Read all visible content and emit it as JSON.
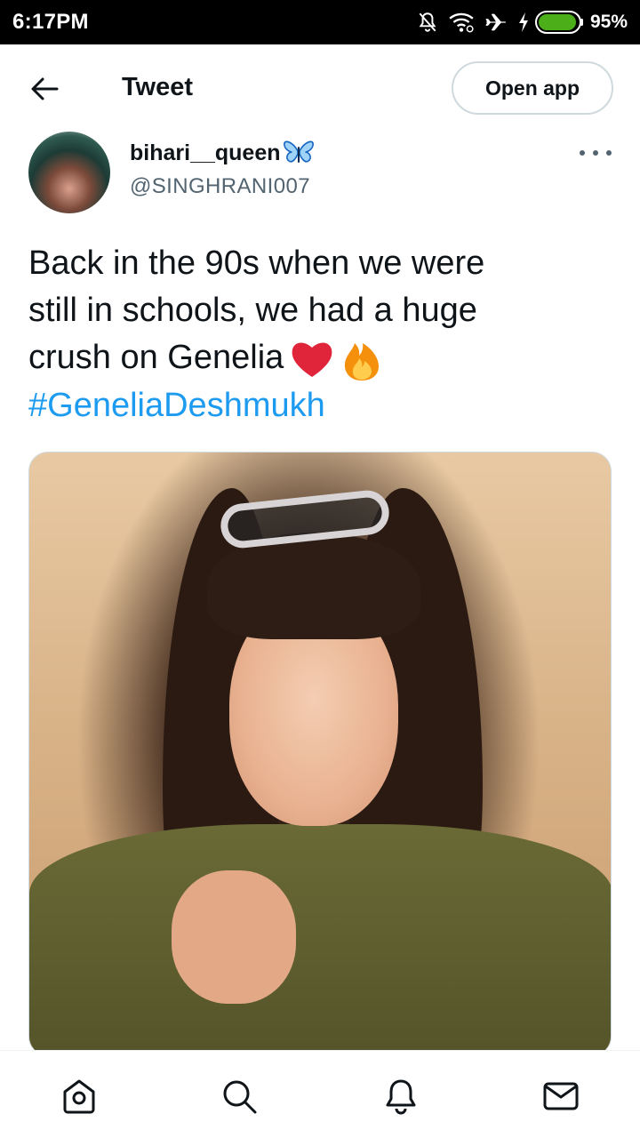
{
  "status_bar": {
    "time": "6:17PM",
    "battery_percent": "95%",
    "battery_level": 0.95,
    "icons": [
      "silent-icon",
      "wifi-icon",
      "airplane-mode-icon",
      "charging-icon",
      "battery-icon"
    ]
  },
  "header": {
    "title": "Tweet",
    "open_app_label": "Open app"
  },
  "tweet": {
    "display_name": "bihari__queen",
    "name_emoji": "butterfly-icon",
    "handle": "@SINGHRANI007",
    "text_lines": [
      "Back in the 90s when we were",
      "still in schools, we had a huge",
      "crush on Genelia"
    ],
    "text_emojis": [
      "heart-icon",
      "fire-icon"
    ],
    "hashtag": "#GeneliaDeshmukh"
  },
  "bottom_nav": {
    "items": [
      "home-icon",
      "search-icon",
      "notifications-icon",
      "messages-icon"
    ]
  },
  "colors": {
    "accent": "#1d9bf0",
    "text": "#0f1419",
    "secondary_text": "#536471",
    "border": "#cfd9de",
    "heart": "#e0243a",
    "butterfly": "#1d9bf0"
  }
}
